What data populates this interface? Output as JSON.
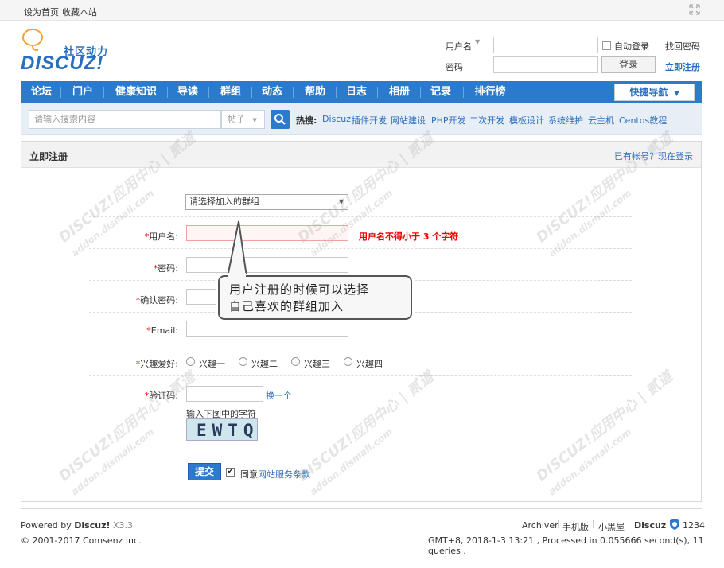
{
  "topbar": {
    "set_home": "设为首页",
    "favorite": "收藏本站"
  },
  "logo": {
    "subtitle": "社区动力",
    "main": "DISCUZ!"
  },
  "login": {
    "username_label": "用户名",
    "password_label": "密码",
    "auto_login": "自动登录",
    "find_password": "找回密码",
    "login_button": "登录",
    "register_now": "立即注册"
  },
  "nav": {
    "items": [
      "论坛",
      "门户",
      "健康知识",
      "导读",
      "群组",
      "动态",
      "帮助",
      "日志",
      "相册",
      "记录",
      "排行榜"
    ],
    "quick_nav": "快捷导航"
  },
  "search": {
    "placeholder": "请输入搜索内容",
    "scope": "帖子",
    "hot_label": "热搜:",
    "hot_links": [
      "Discuz",
      "插件开发",
      "网站建设",
      "PHP开发",
      "二次开发",
      "模板设计",
      "系统维护",
      "云主机",
      "Centos教程"
    ]
  },
  "panel": {
    "title": "立即注册",
    "have_account": "已有帐号？现在登录"
  },
  "form": {
    "group_select": "请选择加入的群组",
    "username_label": "用户名:",
    "username_error": "用户名不得小于 3 个字符",
    "password_label": "密码:",
    "confirm_label": "确认密码:",
    "email_label": "Email:",
    "interests_label": "兴趣爱好:",
    "interests": [
      "兴趣一",
      "兴趣二",
      "兴趣三",
      "兴趣四"
    ],
    "captcha_label": "验证码:",
    "captcha_change": "换一个",
    "captcha_hint": "输入下图中的字符",
    "captcha_text": "EWTQ",
    "submit": "提交",
    "agree_prefix": "同意",
    "agree_link": "网站服务条款",
    "required_mark": "*"
  },
  "callout": {
    "line1": "用户注册的时候可以选择",
    "line2": "自己喜欢的群组加入"
  },
  "footer": {
    "powered_prefix": "Powered by",
    "powered_name": "Discuz!",
    "version": "X3.3",
    "copyright": "© 2001-2017 Comsenz Inc.",
    "links": [
      "Archiver",
      "手机版",
      "小黑屋",
      "Discuz"
    ],
    "counter": "1234",
    "status": "GMT+8, 2018-1-3 13:21 , Processed in 0.055666 second(s), 11 queries ."
  },
  "watermark": {
    "cn": "DISCUZ!应用中心 | 贰道",
    "url": "addon.dismall.com"
  },
  "colors": {
    "brand_blue": "#2b7acd",
    "error_red": "#ee0000",
    "logo_orange": "#f2a430"
  }
}
